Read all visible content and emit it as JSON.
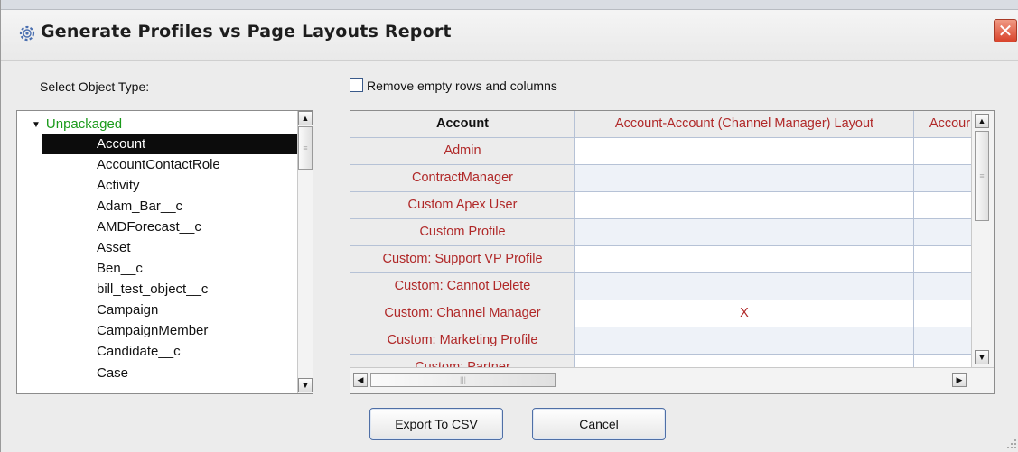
{
  "window": {
    "title": "Generate Profiles vs Page Layouts Report",
    "close_glyph": "✕",
    "title_icon": "gear-icon"
  },
  "object_panel": {
    "label": "Select Object Type:",
    "tree_header": "Unpackaged",
    "selected_index": 0,
    "items": [
      "Account",
      "AccountContactRole",
      "Activity",
      "Adam_Bar__c",
      "AMDForecast__c",
      "Asset",
      "Ben__c",
      "bill_test_object__c",
      "Campaign",
      "CampaignMember",
      "Candidate__c",
      "Case"
    ]
  },
  "options": {
    "remove_empty_label": "Remove empty rows and columns",
    "remove_empty_checked": false
  },
  "report_table": {
    "corner_header": "Account",
    "columns": [
      "Account-Account (Channel Manager) Layout",
      "Accour"
    ],
    "rows": [
      {
        "profile": "Admin",
        "cells": [
          "",
          ""
        ]
      },
      {
        "profile": "ContractManager",
        "cells": [
          "",
          ""
        ]
      },
      {
        "profile": "Custom Apex User",
        "cells": [
          "",
          ""
        ]
      },
      {
        "profile": "Custom Profile",
        "cells": [
          "",
          ""
        ]
      },
      {
        "profile": "Custom:  Support VP Profile",
        "cells": [
          "",
          ""
        ]
      },
      {
        "profile": "Custom: Cannot Delete",
        "cells": [
          "",
          ""
        ]
      },
      {
        "profile": "Custom: Channel Manager",
        "cells": [
          "X",
          ""
        ]
      },
      {
        "profile": "Custom: Marketing Profile",
        "cells": [
          "",
          ""
        ]
      },
      {
        "profile": "Custom: Partner",
        "cells": [
          "",
          ""
        ]
      }
    ]
  },
  "scrollbars": {
    "up": "▲",
    "down": "▼",
    "left": "◀",
    "right": "▶"
  },
  "buttons": {
    "export": "Export To CSV",
    "cancel": "Cancel"
  }
}
